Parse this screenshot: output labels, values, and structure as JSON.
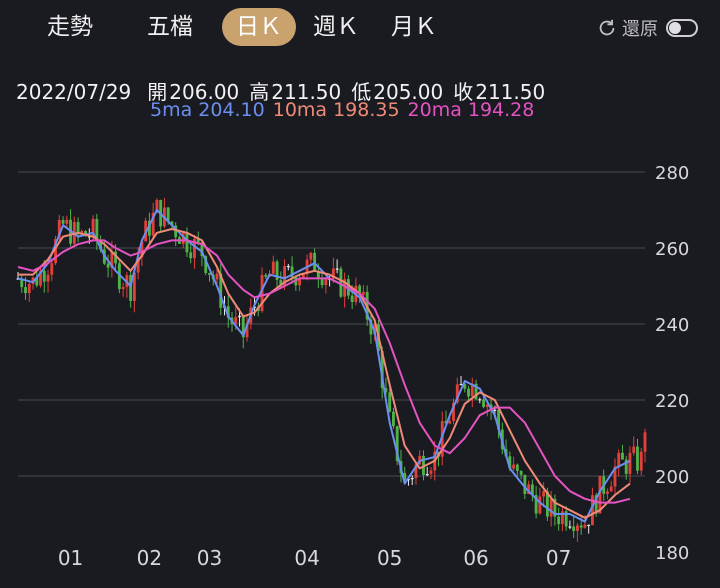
{
  "tabs": [
    {
      "label": "走勢",
      "active": false
    },
    {
      "label": "五檔",
      "active": false
    },
    {
      "label": "日Ｋ",
      "active": true
    },
    {
      "label": "週Ｋ",
      "active": false
    },
    {
      "label": "月Ｋ",
      "active": false
    }
  ],
  "restore": {
    "label": "還原",
    "toggle_on": false,
    "icon": "refresh-icon"
  },
  "quote": {
    "date": "2022/07/29",
    "open_label": "開",
    "open": "206.00",
    "high_label": "高",
    "high": "211.50",
    "low_label": "低",
    "low": "205.00",
    "close_label": "收",
    "close": "211.50"
  },
  "ma": [
    {
      "label": "5ma",
      "value": "204.10",
      "color": "#6b8ff0"
    },
    {
      "label": "10ma",
      "value": "198.35",
      "color": "#f08a78"
    },
    {
      "label": "20ma",
      "value": "194.28",
      "color": "#e453c2"
    }
  ],
  "colors": {
    "up": "#e2403a",
    "down": "#4fb348",
    "grid": "#4a4b50",
    "axis_text": "#d8d8dc",
    "flat": "#e8e8e8"
  },
  "chart_data": {
    "type": "line",
    "yticks": [
      280,
      260,
      240,
      220,
      200,
      180
    ],
    "ylim": [
      180,
      280
    ],
    "xlim": [
      1,
      168
    ],
    "xticks": [
      {
        "label": "01",
        "x": 15
      },
      {
        "label": "02",
        "x": 36
      },
      {
        "label": "03",
        "x": 52
      },
      {
        "label": "04",
        "x": 78
      },
      {
        "label": "05",
        "x": 100
      },
      {
        "label": "06",
        "x": 123
      },
      {
        "label": "07",
        "x": 145
      }
    ],
    "series": [
      {
        "name": "5ma",
        "color": "#6b8ff0",
        "points": [
          [
            1,
            252
          ],
          [
            5,
            251
          ],
          [
            9,
            256
          ],
          [
            13,
            266
          ],
          [
            17,
            263
          ],
          [
            21,
            264
          ],
          [
            24,
            258
          ],
          [
            27,
            254
          ],
          [
            31,
            250
          ],
          [
            34,
            262
          ],
          [
            38,
            270
          ],
          [
            42,
            266
          ],
          [
            46,
            262
          ],
          [
            50,
            259
          ],
          [
            54,
            250
          ],
          [
            57,
            242
          ],
          [
            61,
            237
          ],
          [
            64,
            245
          ],
          [
            68,
            253
          ],
          [
            72,
            252
          ],
          [
            76,
            254
          ],
          [
            80,
            256
          ],
          [
            84,
            252
          ],
          [
            88,
            250
          ],
          [
            92,
            247
          ],
          [
            96,
            238
          ],
          [
            100,
            214
          ],
          [
            104,
            198
          ],
          [
            108,
            204
          ],
          [
            112,
            205
          ],
          [
            116,
            216
          ],
          [
            120,
            225
          ],
          [
            124,
            223
          ],
          [
            128,
            216
          ],
          [
            132,
            202
          ],
          [
            136,
            197
          ],
          [
            140,
            193
          ],
          [
            144,
            190
          ],
          [
            148,
            190
          ],
          [
            152,
            188
          ],
          [
            156,
            196
          ],
          [
            160,
            202
          ],
          [
            164,
            204
          ]
        ]
      },
      {
        "name": "10ma",
        "color": "#f08a78",
        "points": [
          [
            1,
            253
          ],
          [
            5,
            253
          ],
          [
            9,
            257
          ],
          [
            13,
            263
          ],
          [
            17,
            264
          ],
          [
            21,
            263
          ],
          [
            24,
            261
          ],
          [
            27,
            258
          ],
          [
            31,
            254
          ],
          [
            34,
            258
          ],
          [
            38,
            264
          ],
          [
            42,
            265
          ],
          [
            46,
            264
          ],
          [
            50,
            262
          ],
          [
            54,
            255
          ],
          [
            57,
            248
          ],
          [
            61,
            242
          ],
          [
            64,
            243
          ],
          [
            68,
            248
          ],
          [
            72,
            251
          ],
          [
            76,
            253
          ],
          [
            80,
            254
          ],
          [
            84,
            253
          ],
          [
            88,
            251
          ],
          [
            92,
            248
          ],
          [
            96,
            241
          ],
          [
            100,
            224
          ],
          [
            104,
            208
          ],
          [
            108,
            202
          ],
          [
            112,
            204
          ],
          [
            116,
            210
          ],
          [
            120,
            219
          ],
          [
            124,
            222
          ],
          [
            128,
            220
          ],
          [
            132,
            212
          ],
          [
            136,
            204
          ],
          [
            140,
            198
          ],
          [
            144,
            193
          ],
          [
            148,
            191
          ],
          [
            152,
            189
          ],
          [
            156,
            191
          ],
          [
            160,
            195
          ],
          [
            164,
            198
          ]
        ]
      },
      {
        "name": "20ma",
        "color": "#e453c2",
        "points": [
          [
            1,
            255
          ],
          [
            5,
            254
          ],
          [
            9,
            256
          ],
          [
            13,
            259
          ],
          [
            17,
            261
          ],
          [
            21,
            262
          ],
          [
            24,
            262
          ],
          [
            27,
            260
          ],
          [
            31,
            258
          ],
          [
            34,
            259
          ],
          [
            38,
            261
          ],
          [
            42,
            262
          ],
          [
            46,
            262
          ],
          [
            50,
            261
          ],
          [
            54,
            258
          ],
          [
            57,
            253
          ],
          [
            61,
            249
          ],
          [
            64,
            247
          ],
          [
            68,
            248
          ],
          [
            72,
            250
          ],
          [
            76,
            252
          ],
          [
            80,
            252
          ],
          [
            84,
            252
          ],
          [
            88,
            250
          ],
          [
            92,
            248
          ],
          [
            96,
            244
          ],
          [
            100,
            235
          ],
          [
            104,
            224
          ],
          [
            108,
            214
          ],
          [
            112,
            208
          ],
          [
            116,
            206
          ],
          [
            120,
            210
          ],
          [
            124,
            216
          ],
          [
            128,
            218
          ],
          [
            132,
            218
          ],
          [
            136,
            214
          ],
          [
            140,
            207
          ],
          [
            144,
            200
          ],
          [
            148,
            196
          ],
          [
            152,
            194
          ],
          [
            156,
            193
          ],
          [
            160,
            193
          ],
          [
            164,
            194
          ]
        ]
      }
    ]
  }
}
